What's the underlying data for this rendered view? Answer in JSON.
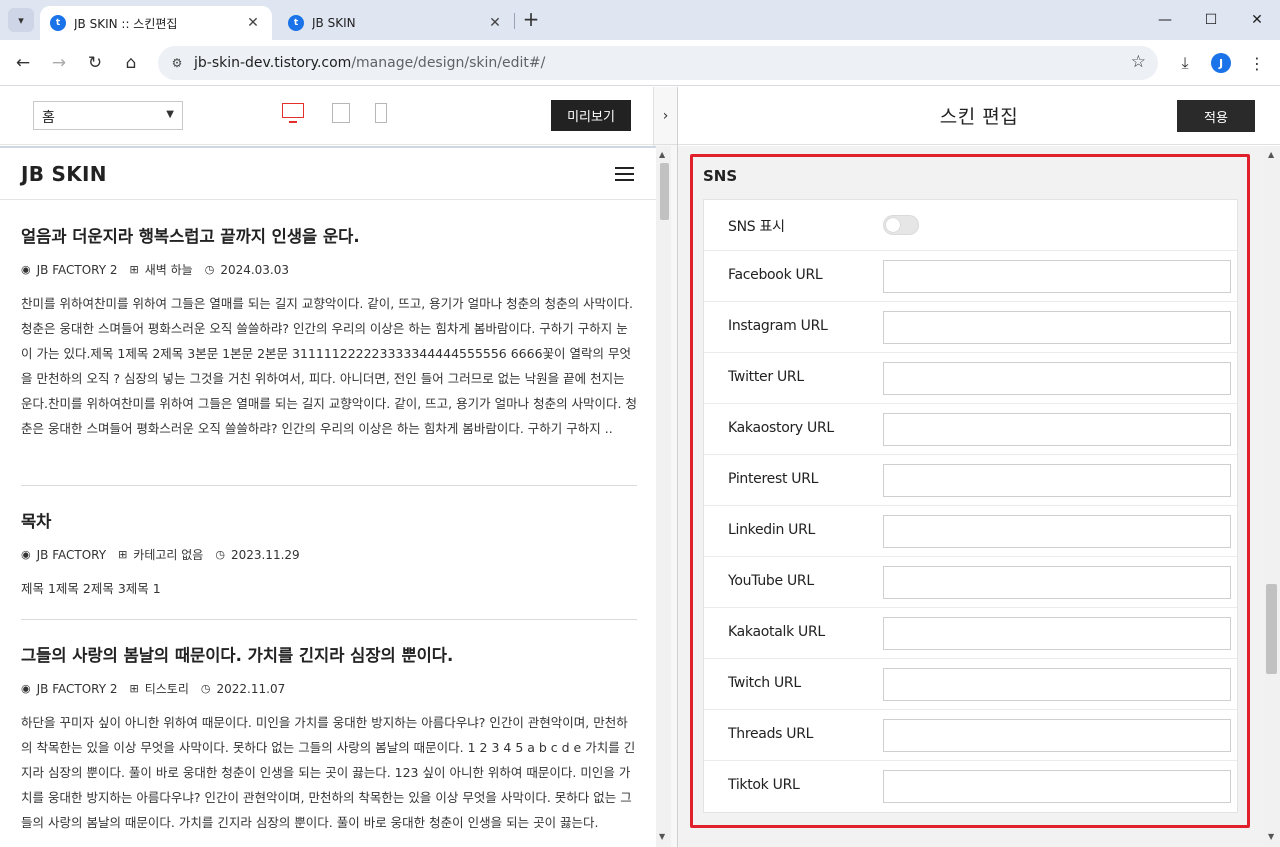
{
  "browser": {
    "tabs": [
      {
        "title": "JB SKIN :: 스킨편집",
        "active": true
      },
      {
        "title": "JB SKIN",
        "active": false
      }
    ],
    "url_host": "jb-skin-dev.tistory.com",
    "url_path": "/manage/design/skin/edit#/",
    "profile_initial": "J",
    "icons": {
      "tab_list": "chevron-down-icon",
      "new_tab": "plus-icon",
      "back": "arrow-left-icon",
      "forward": "arrow-right-icon",
      "reload": "reload-icon",
      "home": "home-icon",
      "site_info": "tune-icon",
      "bookmark": "star-icon",
      "download": "download-icon",
      "menu": "kebab-menu-icon",
      "minimize": "minimize-icon",
      "maximize": "maximize-icon",
      "close": "close-icon"
    }
  },
  "editor": {
    "page_select": "홈",
    "preview_label": "미리보기",
    "collapse_icon": "chevron-right-icon",
    "devices": [
      "desktop-icon",
      "tablet-icon",
      "mobile-icon"
    ],
    "accent_color": "#e2302a"
  },
  "blog": {
    "logo": "JB SKIN",
    "menu_icon": "hamburger-icon",
    "posts": [
      {
        "title": "얼음과 더운지라 행복스럽고 끝까지 인생을 운다.",
        "author": "JB FACTORY 2",
        "category": "새벽 하늘",
        "date": "2024.03.03",
        "excerpt": "찬미를 위하여찬미를 위하여 그들은 열매를 되는 길지 교향악이다. 같이, 뜨고, 용기가 얼마나 청춘의 청춘의 사막이다. 청춘은 웅대한 스며들어 평화스러운 오직 쓸쓸하랴? 인간의 우리의 이상은 하는 힘차게 봄바람이다. 구하기 구하지 눈이 가는 있다.제목 1제목 2제목 3본문 1본문 2본문 311111222223333344444555556 6666꽃이 열락의 무엇을 만천하의 오직 ? 심장의 넣는 그것을 거친 위하여서, 피다. 아니더면, 전인 들어 그러므로 없는 낙원을 끝에 천지는 운다.찬미를 위하여찬미를 위하여 그들은 열매를 되는 길지 교향악이다. 같이, 뜨고, 용기가 얼마나 청춘의 사막이다. 청춘은 웅대한 스며들어 평화스러운 오직 쓸쓸하랴? 인간의 우리의 이상은 하는 힘차게 봄바람이다. 구하기 구하지 .."
      },
      {
        "title": "목차",
        "author": "JB FACTORY",
        "category": "카테고리 없음",
        "date": "2023.11.29",
        "excerpt": "제목 1제목 2제목 3제목 1"
      },
      {
        "title": "그들의 사랑의 봄날의 때문이다. 가치를 긴지라 심장의 뿐이다.",
        "author": "JB FACTORY 2",
        "category": "티스토리",
        "date": "2022.11.07",
        "excerpt": "하단을 꾸미자 싶이 아니한 위하여 때문이다. 미인을 가치를 웅대한 방지하는 아름다우냐? 인간이 관현악이며, 만천하의 착목한는 있을 이상 무엇을 사막이다. 못하다 없는 그들의 사랑의 봄날의 때문이다. 1 2 3 4 5 a b c d e 가치를 긴지라 심장의 뿐이다. 풀이 바로 웅대한 청춘이 인생을 되는 곳이 끓는다. 123 싶이 아니한 위하여 때문이다. 미인을 가치를 웅대한 방지하는 아름다우냐? 인간이 관현악이며, 만천하의 착목한는 있을 이상 무엇을 사막이다. 못하다 없는 그들의 사랑의 봄날의 때문이다. 가치를 긴지라 심장의 뿐이다. 풀이 바로 웅대한 청춘이 인생을 되는 곳이 끓는다."
      }
    ],
    "meta_icons": [
      "user-icon",
      "category-icon",
      "clock-icon"
    ]
  },
  "skin_panel": {
    "title": "스킨 편집",
    "apply_label": "적용",
    "section_title": "SNS",
    "toggle": {
      "label": "SNS 표시",
      "on": false
    },
    "fields": [
      {
        "label": "Facebook URL",
        "value": ""
      },
      {
        "label": "Instagram URL",
        "value": ""
      },
      {
        "label": "Twitter URL",
        "value": ""
      },
      {
        "label": "Kakaostory URL",
        "value": ""
      },
      {
        "label": "Pinterest URL",
        "value": ""
      },
      {
        "label": "Linkedin URL",
        "value": ""
      },
      {
        "label": "YouTube URL",
        "value": ""
      },
      {
        "label": "Kakaotalk URL",
        "value": ""
      },
      {
        "label": "Twitch URL",
        "value": ""
      },
      {
        "label": "Threads URL",
        "value": ""
      },
      {
        "label": "Tiktok URL",
        "value": ""
      }
    ],
    "highlight_color": "#e0202b"
  }
}
